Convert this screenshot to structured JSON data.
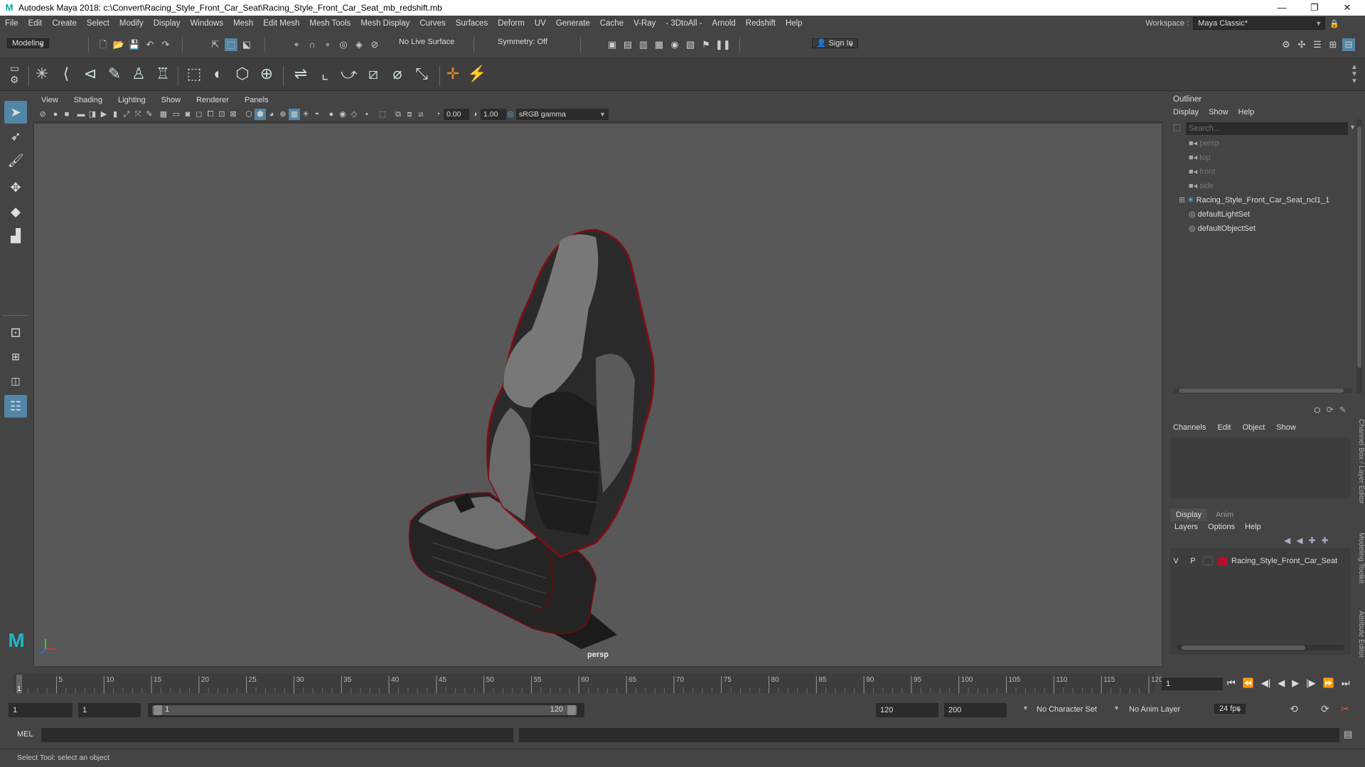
{
  "window": {
    "title": "Autodesk Maya 2018: c:\\Convert\\Racing_Style_Front_Car_Seat\\Racing_Style_Front_Car_Seat_mb_redshift.mb",
    "logo": "M",
    "minimize": "—",
    "maximize": "❐",
    "close": "✕"
  },
  "menu": [
    "File",
    "Edit",
    "Create",
    "Select",
    "Modify",
    "Display",
    "Windows",
    "Mesh",
    "Edit Mesh",
    "Mesh Tools",
    "Mesh Display",
    "Curves",
    "Surfaces",
    "Deform",
    "UV",
    "Generate",
    "Cache",
    "V-Ray",
    "- 3DtoAll -",
    "Arnold",
    "Redshift",
    "Help"
  ],
  "workspace": {
    "label": "Workspace :",
    "value": "Maya Classic*"
  },
  "statusline": {
    "mode": "Modeling",
    "live_surface": "No Live Surface",
    "symmetry": "Symmetry: Off",
    "sign_in": "Sign In"
  },
  "panel_menu": [
    "View",
    "Shading",
    "Lighting",
    "Show",
    "Renderer",
    "Panels"
  ],
  "panel_toolbar": {
    "exposure": "0.00",
    "gamma": "1.00",
    "color_space": "sRGB gamma"
  },
  "viewport": {
    "camera": "persp"
  },
  "outliner": {
    "title": "Outliner",
    "menu": [
      "Display",
      "Show",
      "Help"
    ],
    "search_placeholder": "Search...",
    "items": [
      {
        "label": "persp",
        "type": "camera",
        "dim": true
      },
      {
        "label": "top",
        "type": "camera",
        "dim": true
      },
      {
        "label": "front",
        "type": "camera",
        "dim": true
      },
      {
        "label": "side",
        "type": "camera",
        "dim": true
      },
      {
        "label": "Racing_Style_Front_Car_Seat_ncl1_1",
        "type": "group",
        "dim": false
      },
      {
        "label": "defaultLightSet",
        "type": "set",
        "dim": false
      },
      {
        "label": "defaultObjectSet",
        "type": "set",
        "dim": false
      }
    ]
  },
  "channel_box": {
    "menu": [
      "Channels",
      "Edit",
      "Object",
      "Show"
    ],
    "layer_tabs": [
      "Display",
      "Anim"
    ],
    "layer_menu": [
      "Layers",
      "Options",
      "Help"
    ],
    "layer": {
      "v": "V",
      "p": "P",
      "name": "Racing_Style_Front_Car_Seat",
      "color": "#b0102a"
    }
  },
  "side_tabs": [
    "Channel Box / Layer Editor",
    "Modeling Toolkit",
    "Attribute Editor"
  ],
  "timeline": {
    "ticks": [
      "1",
      "5",
      "10",
      "15",
      "20",
      "25",
      "30",
      "35",
      "40",
      "45",
      "50",
      "55",
      "60",
      "65",
      "70",
      "75",
      "80",
      "85",
      "90",
      "95",
      "100",
      "105",
      "110",
      "115",
      "120"
    ],
    "current_frame": "1"
  },
  "range": {
    "start": "1",
    "playback_start": "1",
    "slider_start": "1",
    "slider_end": "120",
    "playback_end": "120",
    "end": "200",
    "character_set": "No Character Set",
    "anim_layer": "No Anim Layer",
    "fps": "24 fps"
  },
  "command": {
    "label": "MEL"
  },
  "help": {
    "text": "Select Tool: select an object"
  },
  "colors": {
    "accent": "#5285a6",
    "seat_red": "#8a0f18"
  }
}
